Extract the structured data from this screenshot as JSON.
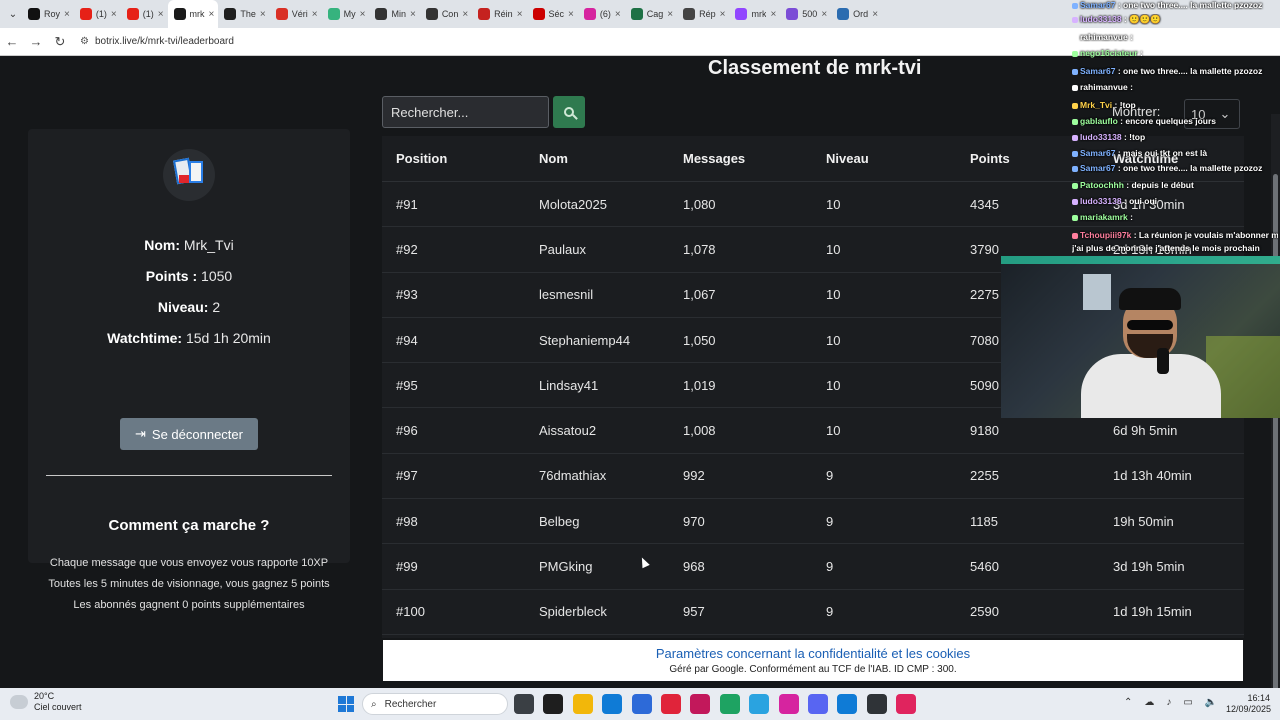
{
  "browser": {
    "tabs": [
      {
        "title": "Roy",
        "color": "#111111"
      },
      {
        "title": "(1) ",
        "color": "#e62117"
      },
      {
        "title": "(1) ",
        "color": "#e62117"
      },
      {
        "title": "mrk",
        "color": "#1b1b1b",
        "active": true
      },
      {
        "title": "The",
        "color": "#1f1f1f"
      },
      {
        "title": "Véri",
        "color": "#d93025"
      },
      {
        "title": "My",
        "color": "#36b37e"
      },
      {
        "title": "Min",
        "color": "#333333"
      },
      {
        "title": "Con",
        "color": "#333333"
      },
      {
        "title": "Réin",
        "color": "#c5221f"
      },
      {
        "title": "Séc",
        "color": "#cc0000"
      },
      {
        "title": "(6) ",
        "color": "#d6249f"
      },
      {
        "title": "Cag",
        "color": "#1e7145"
      },
      {
        "title": "Rép",
        "color": "#444444"
      },
      {
        "title": "mrk",
        "color": "#9146ff"
      },
      {
        "title": "500",
        "color": "#7b4dd6"
      },
      {
        "title": "Ord",
        "color": "#2b6cb0"
      }
    ],
    "url": "botrix.live/k/mrk-tvi/leaderboard"
  },
  "profile": {
    "name_label": "Nom:",
    "name_value": " Mrk_Tvi",
    "points_label": "Points :",
    "points_value": " 1050",
    "level_label": "Niveau:",
    "level_value": " 2",
    "watch_label": "Watchtime:",
    "watch_value": " 15d 1h 20min",
    "logout_label": "Se déconnecter"
  },
  "how": {
    "title": "Comment ça marche ?",
    "lines": [
      "Chaque message que vous envoyez vous rapporte 10XP",
      "Toutes les 5 minutes de visionnage, vous gagnez 5 points",
      "Les abonnés gagnent 0 points supplémentaires"
    ]
  },
  "leaderboard": {
    "title": "Classement de mrk-tvi",
    "search_placeholder": "Rechercher...",
    "show_label": "Montrer:",
    "show_value": "10",
    "headers": [
      "Position",
      "Nom",
      "Messages",
      "Niveau",
      "Points",
      "Watchtime"
    ],
    "rows": [
      [
        "#91",
        "Molota2025",
        "1,080",
        "10",
        "4345",
        "3d 1h 30min"
      ],
      [
        "#92",
        "Paulaux",
        "1,078",
        "10",
        "3790",
        "2d 13h 10min"
      ],
      [
        "#93",
        "lesmesnil",
        "1,067",
        "10",
        "2275",
        ""
      ],
      [
        "#94",
        "Stephaniemp44",
        "1,050",
        "10",
        "7080",
        ""
      ],
      [
        "#95",
        "Lindsay41",
        "1,019",
        "10",
        "5090",
        ""
      ],
      [
        "#96",
        "Aissatou2",
        "1,008",
        "10",
        "9180",
        "6d 9h 5min"
      ],
      [
        "#97",
        "76dmathiax",
        "992",
        "9",
        "2255",
        "1d 13h 40min"
      ],
      [
        "#98",
        "Belbeg",
        "970",
        "9",
        "1185",
        "19h 50min"
      ],
      [
        "#99",
        "PMGking",
        "968",
        "9",
        "5460",
        "3d 19h 5min"
      ],
      [
        "#100",
        "Spiderbleck",
        "957",
        "9",
        "2590",
        "1d 19h 15min"
      ]
    ]
  },
  "cookie": {
    "line1": "Paramètres concernant la confidentialité et les cookies",
    "line2": "Géré par Google. Conformément au TCF de l'IAB. ID CMP : 300."
  },
  "chat": [
    {
      "user": "Samar67",
      "text": ": one two three.... la mallette pzozoz",
      "color": "#7fb2ff"
    },
    {
      "user": "ludo33138",
      "text": ": 🙂🙂🙂",
      "color": "#d7b2ff"
    },
    {
      "user": "rahimanvue",
      "text": ":",
      "color": "#ffffff"
    },
    {
      "user": "nego16ciateur",
      "text": ":",
      "color": "#9eff9e"
    },
    {
      "user": "Samar67",
      "text": ": one two three.... la mallette pzozoz",
      "color": "#7fb2ff"
    },
    {
      "user": "rahimanvue",
      "text": ":",
      "color": "#ffffff"
    },
    {
      "user": "Mrk_Tvi",
      "text": ": !top",
      "color": "#ffd24a"
    },
    {
      "user": "gablauflo",
      "text": ": encore quelques jours",
      "color": "#9eff9e"
    },
    {
      "user": "ludo33138",
      "text": ": !top",
      "color": "#d7b2ff"
    },
    {
      "user": "Samar67",
      "text": ": mais oui tkt on est là",
      "color": "#7fb2ff"
    },
    {
      "user": "Samar67",
      "text": ": one two three.... la mallette pzozoz",
      "color": "#7fb2ff"
    },
    {
      "user": "Patoochhh",
      "text": ": depuis le début",
      "color": "#9eff9e"
    },
    {
      "user": "ludo33138",
      "text": ": oui oui",
      "color": "#d7b2ff"
    },
    {
      "user": "mariakamrk",
      "text": ":",
      "color": "#9eff9e"
    },
    {
      "user": "Tchoupiii97k",
      "text": ": La réunion je voulais m'abonner mais",
      "color": "#ff7f9e"
    },
    {
      "user": "",
      "text": "j'ai plus de monnaie j'attends le mois prochain",
      "color": "#ffffff"
    }
  ],
  "taskbar": {
    "temp": "20°C",
    "weather": "Ciel couvert",
    "search": "Rechercher",
    "time": "16:14",
    "date": "12/09/2025",
    "icons": [
      "#3a3f44",
      "#1e1e1e",
      "#f2b70a",
      "#0f7bd6",
      "#2d6ad8",
      "#e0243a",
      "#c2185b",
      "#1ea362",
      "#2aa3e0",
      "#d6249f",
      "#5865f2",
      "#0f7bd6",
      "#2f3337",
      "#e0245e"
    ]
  }
}
